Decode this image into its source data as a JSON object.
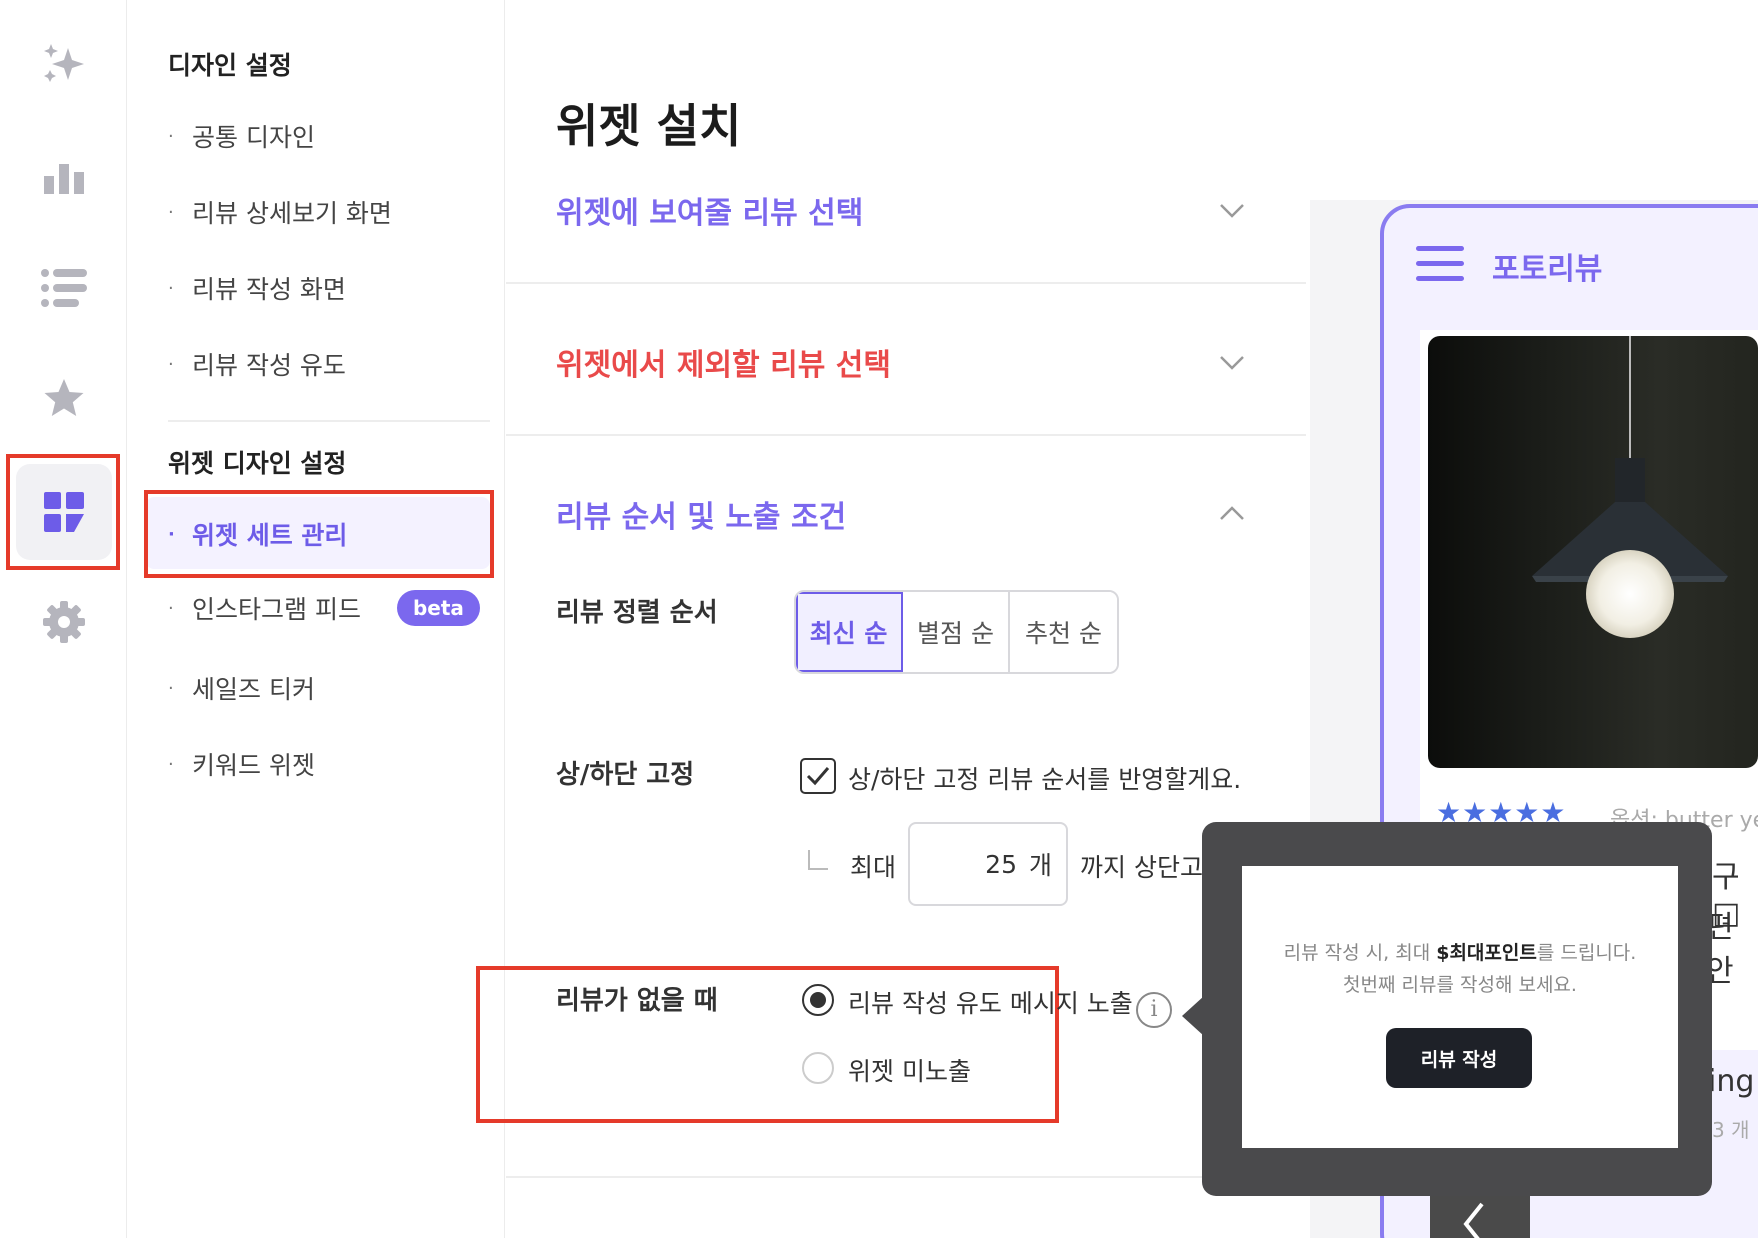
{
  "sidebar_rail": {
    "items": [
      {
        "icon": "sparkles-icon"
      },
      {
        "icon": "bar-chart-icon"
      },
      {
        "icon": "list-icon"
      },
      {
        "icon": "star-icon"
      },
      {
        "icon": "widget-grid-icon",
        "active": true
      },
      {
        "icon": "gear-icon"
      }
    ]
  },
  "submenu": {
    "design_heading": "디자인 설정",
    "design_items": [
      "공통 디자인",
      "리뷰 상세보기 화면",
      "리뷰 작성 화면",
      "리뷰 작성 유도"
    ],
    "widget_heading": "위젯 디자인 설정",
    "widget_items": [
      "위젯 세트 관리",
      "인스타그램 피드",
      "세일즈 티커",
      "키워드 위젯"
    ],
    "active_item": "위젯 세트 관리",
    "beta_badge": "beta"
  },
  "main": {
    "page_title": "위젯 설치",
    "sections": [
      {
        "title": "위젯에 보여줄 리뷰 선택",
        "expanded": false
      },
      {
        "title": "위젯에서 제외할 리뷰 선택",
        "expanded": false,
        "color": "#e94a4a"
      },
      {
        "title": "리뷰 순서 및 노출 조건",
        "expanded": true,
        "color": "#7b68ee"
      }
    ],
    "sort_label": "리뷰 정렬 순서",
    "sort_options": [
      "최신 순",
      "별점 순",
      "추천 순"
    ],
    "sort_selected": "최신 순",
    "pin_label": "상/하단 고정",
    "pin_checkbox_label": "상/하단 고정 리뷰 순서를 반영할게요.",
    "pin_checked": true,
    "max_prefix": "최대",
    "max_value": "25",
    "max_unit": "개",
    "max_suffix": "까지 상단고",
    "noreview_label": "리뷰가 없을 때",
    "noreview_options": [
      "리뷰 작성 유도 메시지 노출",
      "위젯 미노출"
    ],
    "noreview_selected": "리뷰 작성 유도 메시지 노출"
  },
  "tooltip": {
    "line1_prefix": "리뷰 작성 시, 최대 ",
    "line1_bold": "$최대포인트",
    "line1_suffix": "를 드립니다.",
    "line2": "첫번째 리뷰를 작성해 보세요.",
    "button": "리뷰 작성"
  },
  "preview": {
    "brand": "포토리뷰",
    "stars": "★★★★★",
    "option_text": "옵션: butter yel",
    "partial_1": "구□",
    "partial_2": "편안",
    "partial_3": "ing",
    "partial_4": "3 개"
  },
  "colors": {
    "accent": "#7b68ee",
    "danger": "#e94a4a",
    "highlight_box": "#e53a2a"
  }
}
